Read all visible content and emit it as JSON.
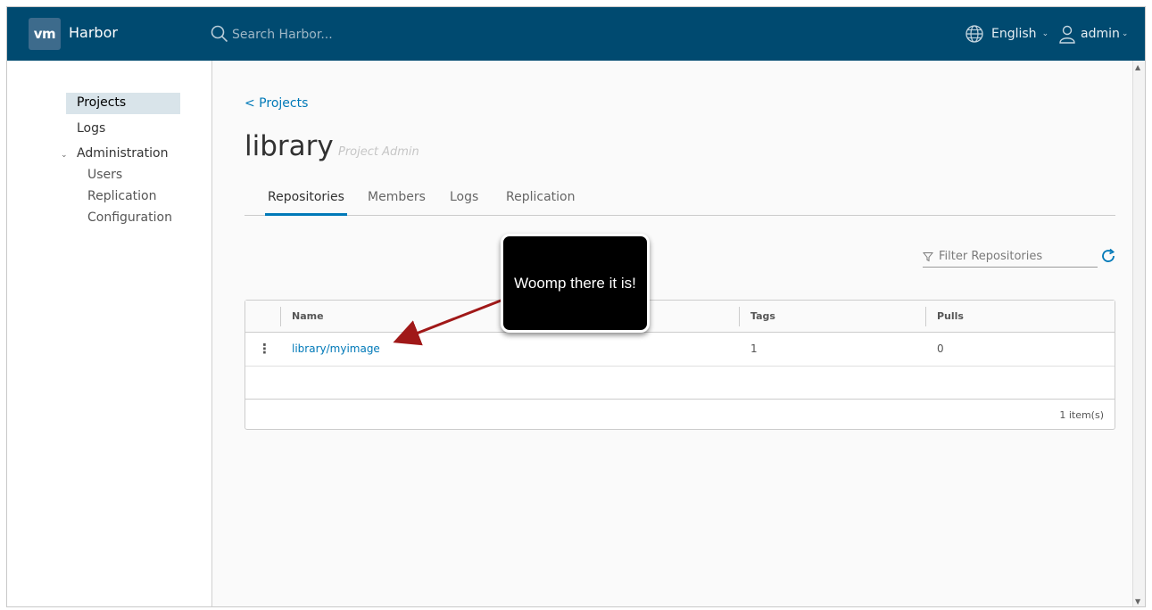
{
  "header": {
    "logo_text": "vm",
    "app_name": "Harbor",
    "search_placeholder": "Search Harbor...",
    "language": "English",
    "user": "admin"
  },
  "sidebar": {
    "projects": "Projects",
    "logs": "Logs",
    "administration": "Administration",
    "admin_items": [
      "Users",
      "Replication",
      "Configuration"
    ]
  },
  "page": {
    "back_link": "< Projects",
    "project_name": "library",
    "role": "Project Admin",
    "tabs": [
      "Repositories",
      "Members",
      "Logs",
      "Replication"
    ]
  },
  "filter": {
    "placeholder": "Filter Repositories"
  },
  "table": {
    "columns": [
      "Name",
      "Tags",
      "Pulls"
    ],
    "rows": [
      {
        "name": "library/myimage",
        "tags": "1",
        "pulls": "0"
      }
    ],
    "count": "1 item(s)"
  },
  "annotation": {
    "text": "Woomp there it is!"
  },
  "colors": {
    "header": "#004a70",
    "accent": "#0079b8",
    "arrow": "#a01818"
  }
}
